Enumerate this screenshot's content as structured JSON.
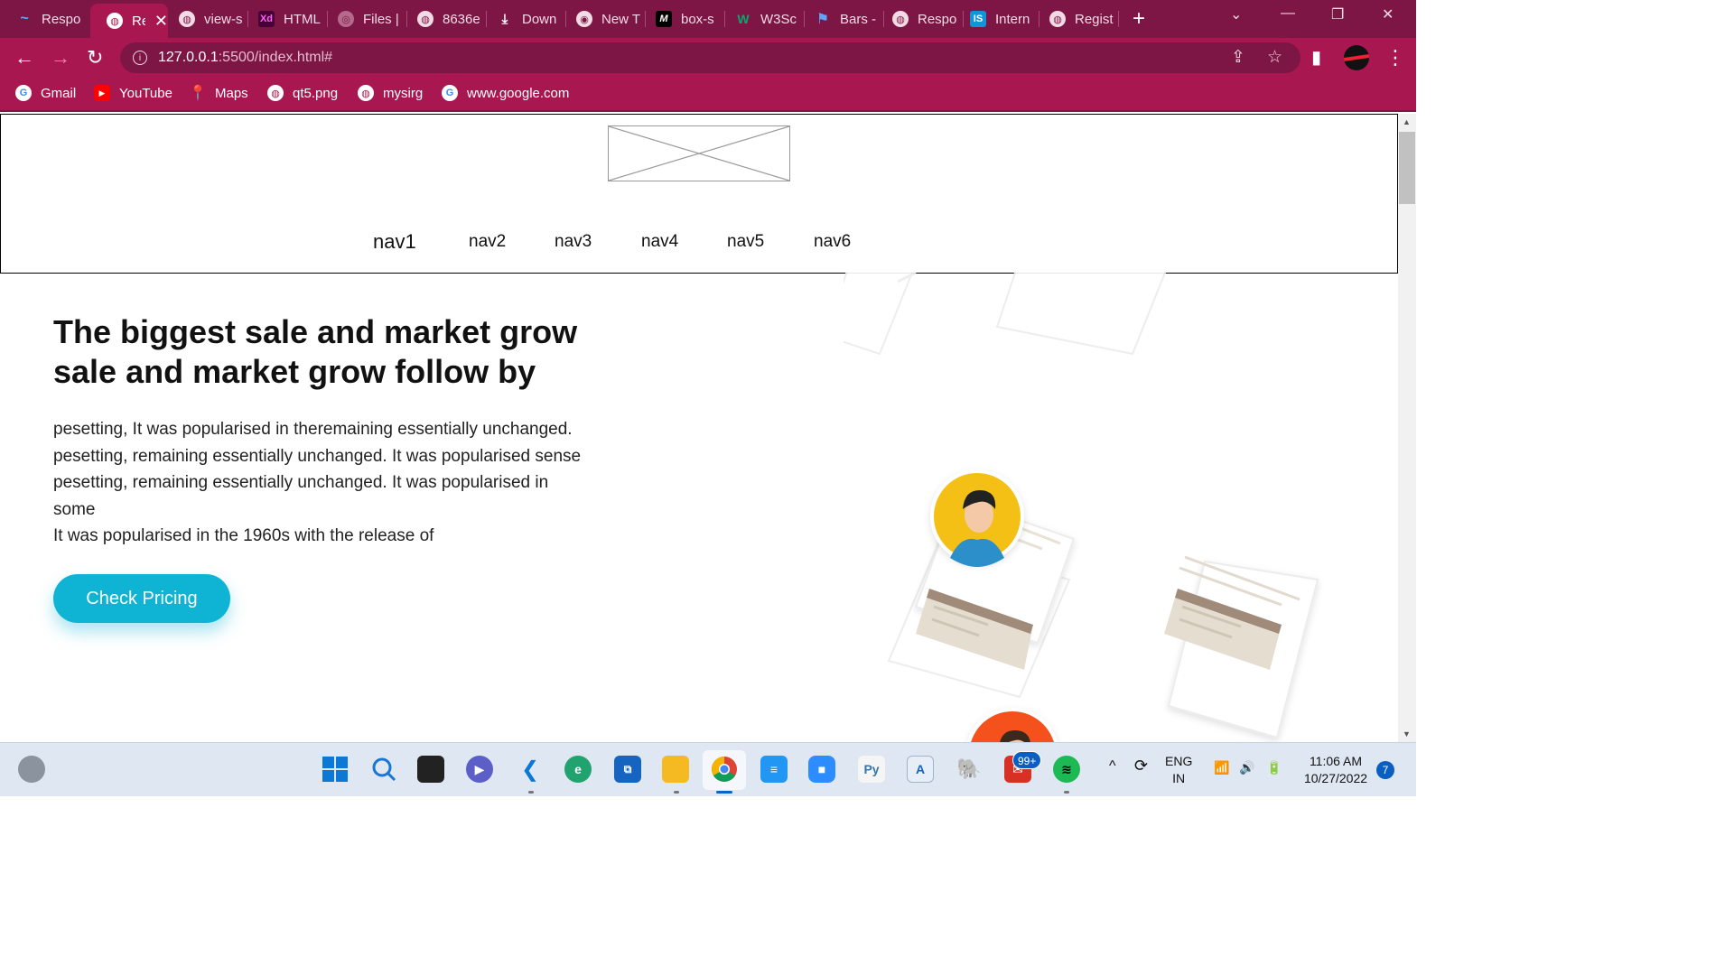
{
  "browser": {
    "tabs": [
      {
        "label": "Respo",
        "icon": "tailwind-icon",
        "color": "#38bdf8"
      },
      {
        "label": "Re",
        "icon": "globe-icon",
        "active": true,
        "close": "✕"
      },
      {
        "label": "view-s",
        "icon": "globe-icon"
      },
      {
        "label": "HTML",
        "icon": "xd-icon",
        "color": "#470137"
      },
      {
        "label": "Files |",
        "icon": "files-icon"
      },
      {
        "label": "8636e",
        "icon": "globe-icon"
      },
      {
        "label": "Down",
        "icon": "download-icon"
      },
      {
        "label": "New T",
        "icon": "chrome-icon"
      },
      {
        "label": "box-s",
        "icon": "mdn-icon"
      },
      {
        "label": "W3Sc",
        "icon": "w3schools-icon",
        "color": "#04aa6d"
      },
      {
        "label": "Bars -",
        "icon": "flag-icon",
        "color": "#3b82f6"
      },
      {
        "label": "Respo",
        "icon": "globe-icon"
      },
      {
        "label": "Intern",
        "icon": "internshala-icon",
        "color": "#1295d8"
      },
      {
        "label": "Regist",
        "icon": "globe-icon"
      }
    ],
    "new_tab": "+",
    "window_controls": {
      "dropdown": "⌄",
      "minimize": "—",
      "restore": "❐",
      "close": "✕"
    },
    "nav": {
      "back": "←",
      "forward": "→",
      "reload": "↻"
    },
    "url": {
      "host": "127.0.0.1",
      "rest": ":5500/index.html#"
    },
    "omnibox_icons": {
      "share": "⇪",
      "bookmark": "☆",
      "sidepanel": "▮",
      "menu": "⋮"
    },
    "bookmarks": [
      {
        "label": "Gmail",
        "icon": "google-icon"
      },
      {
        "label": "YouTube",
        "icon": "youtube-icon"
      },
      {
        "label": "Maps",
        "icon": "maps-icon"
      },
      {
        "label": "qt5.png",
        "icon": "globe-icon"
      },
      {
        "label": "mysirg",
        "icon": "globe-icon"
      },
      {
        "label": "www.google.com",
        "icon": "google-icon"
      }
    ]
  },
  "page": {
    "nav": [
      "nav1",
      "nav2",
      "nav3",
      "nav4",
      "nav5",
      "nav6"
    ],
    "hero": {
      "title": "The biggest sale and market grow sale and market grow follow by",
      "paragraph_lines": [
        "pesetting, It was popularised in theremaining essentially unchanged.",
        "pesetting, remaining essentially unchanged. It was popularised sense",
        "pesetting, remaining essentially unchanged. It was popularised in",
        "some",
        "It was popularised in the 1960s with the release of"
      ],
      "cta": "Check Pricing"
    },
    "colors": {
      "cta": "#0fb4d5",
      "chrome": "#a8174f",
      "chrome_dark": "#7d1644"
    }
  },
  "taskbar": {
    "language": {
      "line1": "ENG",
      "line2": "IN"
    },
    "clock": {
      "time": "11:06 AM",
      "date": "10/27/2022"
    },
    "mail_badge": "99+",
    "notifications": "7",
    "tray_icons": {
      "chevron": "^",
      "wifi": "📶",
      "volume": "🔊",
      "battery": "🔋"
    }
  }
}
